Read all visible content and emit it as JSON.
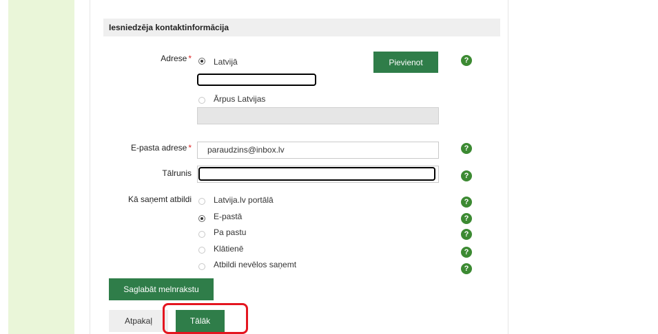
{
  "section": {
    "title": "Iesniedzēja kontaktinformācija"
  },
  "address": {
    "label": "Adrese",
    "required_mark": "*",
    "option_latvia": "Latvijā",
    "option_abroad": "Ārpus Latvijas",
    "add_button": "Pievienot"
  },
  "email": {
    "label": "E-pasta adrese",
    "required_mark": "*",
    "value": "paraudzins@inbox.lv"
  },
  "phone": {
    "label": "Tālrunis",
    "value": ""
  },
  "response": {
    "label": "Kā saņemt atbildi",
    "options": [
      "Latvija.lv portālā",
      "E-pastā",
      "Pa pastu",
      "Klātienē",
      "Atbildi nevēlos saņemt"
    ],
    "selected": "E-pastā"
  },
  "help_icon_text": "?",
  "buttons": {
    "save_draft": "Saglabāt melnrakstu",
    "back": "Atpakaļ",
    "next": "Tālāk"
  },
  "colors": {
    "accent_green": "#2f7d49",
    "help_green": "#3c8a32",
    "highlight_red": "#e4151f",
    "strip_green": "#eaf6d9"
  }
}
